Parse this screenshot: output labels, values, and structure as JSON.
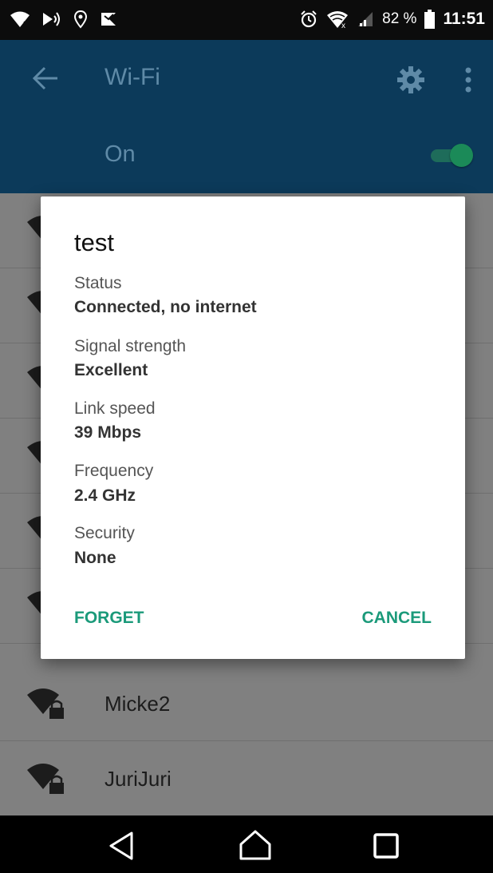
{
  "status_bar": {
    "battery_text": "82 %",
    "time": "11:51",
    "icons": [
      "wifi-question-icon",
      "nfc-icon",
      "location-icon",
      "notification-icon",
      "alarm-icon",
      "wifi-x-icon",
      "cellular-signal-icon",
      "battery-icon"
    ]
  },
  "app_bar": {
    "title": "Wi-Fi",
    "back_icon": "back-arrow-icon",
    "settings_icon": "gear-icon",
    "more_icon": "more-vert-icon"
  },
  "toggle": {
    "label": "On",
    "state": "on",
    "accent_color": "#1b8a58"
  },
  "networks": [
    {
      "name": "Micke2"
    },
    {
      "name": "JuriJuri"
    }
  ],
  "dialog": {
    "title": "test",
    "fields": [
      {
        "label": "Status",
        "value": "Connected, no internet"
      },
      {
        "label": "Signal strength",
        "value": "Excellent"
      },
      {
        "label": "Link speed",
        "value": "39 Mbps"
      },
      {
        "label": "Frequency",
        "value": "2.4 GHz"
      },
      {
        "label": "Security",
        "value": "None"
      }
    ],
    "forget_label": "FORGET",
    "cancel_label": "CANCEL",
    "button_color": "#1b9a7a"
  },
  "nav_bar": {
    "icons": [
      "back-triangle-icon",
      "home-icon",
      "recents-icon"
    ]
  }
}
